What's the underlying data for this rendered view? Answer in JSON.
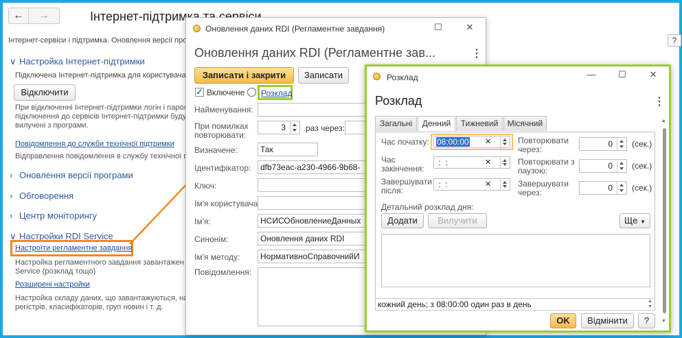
{
  "main": {
    "title": "Інтернет-підтримка та сервіси",
    "subtitle": "Інтернет-сервіси і підтримка. Оновлення версії прог",
    "sections": {
      "isp": "Настройка Інтернет-підтримки",
      "updates": "Оновлення версії програми",
      "discussions": "Обговорення",
      "monitoring": "Центр моніторингу",
      "rdi": "Настройки RDI Service"
    },
    "isp_status": "Підключена Інтернет-підтримка для користувача",
    "disconnect_label": "Відключити",
    "disconnect_note": "При відключенні Інтернет-підтримки логін і пароль\nпідключення до сервісів Інтернет-підтримки будут\nвилучені з програми.",
    "support_link": "Повідомлення до служби технічної підтримки",
    "support_note": "Відправлення повідомлення в службу технічної під",
    "rdi_settings_link": "Настроїти регламентне завдання",
    "rdi_settings_note": "Настройка регламентного завдання завантажен\nService (розклад тощо)",
    "advanced_link": "Розширені настройки",
    "advanced_note": "Настройка складу даних, що завантажуються, на\nрегістрів, класифікаторів, груп новин і т. д."
  },
  "task": {
    "window_title": "Оновлення даних RDI (Регламентне завдання)",
    "heading": "Оновлення даних RDI (Регламентне зав...",
    "save_close_label": "Записати і закрити",
    "save_label": "Записати",
    "enabled_label": "Включене",
    "schedule_link": "Розклад",
    "fields": {
      "name_label": "Найменування:",
      "retry_label": "При помилках\nповторювати:",
      "retry_value": "3",
      "retry_suffix": "раз через:",
      "predefined_label": "Визначене:",
      "predefined_value": "Так",
      "id_label": "Ідентифікатор:",
      "id_value": "dfb73eac-a230-4966-9b68-",
      "key_label": "Ключ:",
      "user_label": "Ім'я користувача:",
      "name2_label": "Ім'я:",
      "name2_value": "НСИСОбновлениеДанных",
      "synonym_label": "Синонім:",
      "synonym_value": "Оновлення даних RDI",
      "method_label": "Ім'я методу:",
      "method_value": "НормативноСправочнийИ",
      "messages_label": "Повідомлення:"
    }
  },
  "schedule": {
    "window_title": "Розклад",
    "heading": "Розклад",
    "tabs": [
      "Загальні",
      "Денний",
      "Тижневий",
      "Місячний"
    ],
    "start_label": "Час початку:",
    "start_value": "08:00:00",
    "end_label": "Час\nзакінчення:",
    "end_value": " :  : ",
    "finish_after_label": "Завершувати\nпісля:",
    "finish_after_value": " :  : ",
    "repeat_every_label": "Повторювати\nчерез:",
    "repeat_every_value": "0",
    "repeat_pause_label": "Повторювати з\nпаузою:",
    "repeat_pause_value": "0",
    "finish_in_label": "Завершувати\nчерез:",
    "finish_in_value": "0",
    "sec_unit": "(сек.)",
    "detail_label": "Детальний розклад дня:",
    "add_label": "Додати",
    "delete_label": "Вилучити",
    "more_label": "Ще",
    "summary": "кожний день; з 08:00:00 один раз в день",
    "ok_label": "OK",
    "cancel_label": "Відмінити",
    "help_label": "?"
  },
  "colors": {
    "frame": "#1ca7e8",
    "highlight_orange": "#f08a24",
    "highlight_green": "#9ccc33",
    "link": "#1d4f9c"
  }
}
